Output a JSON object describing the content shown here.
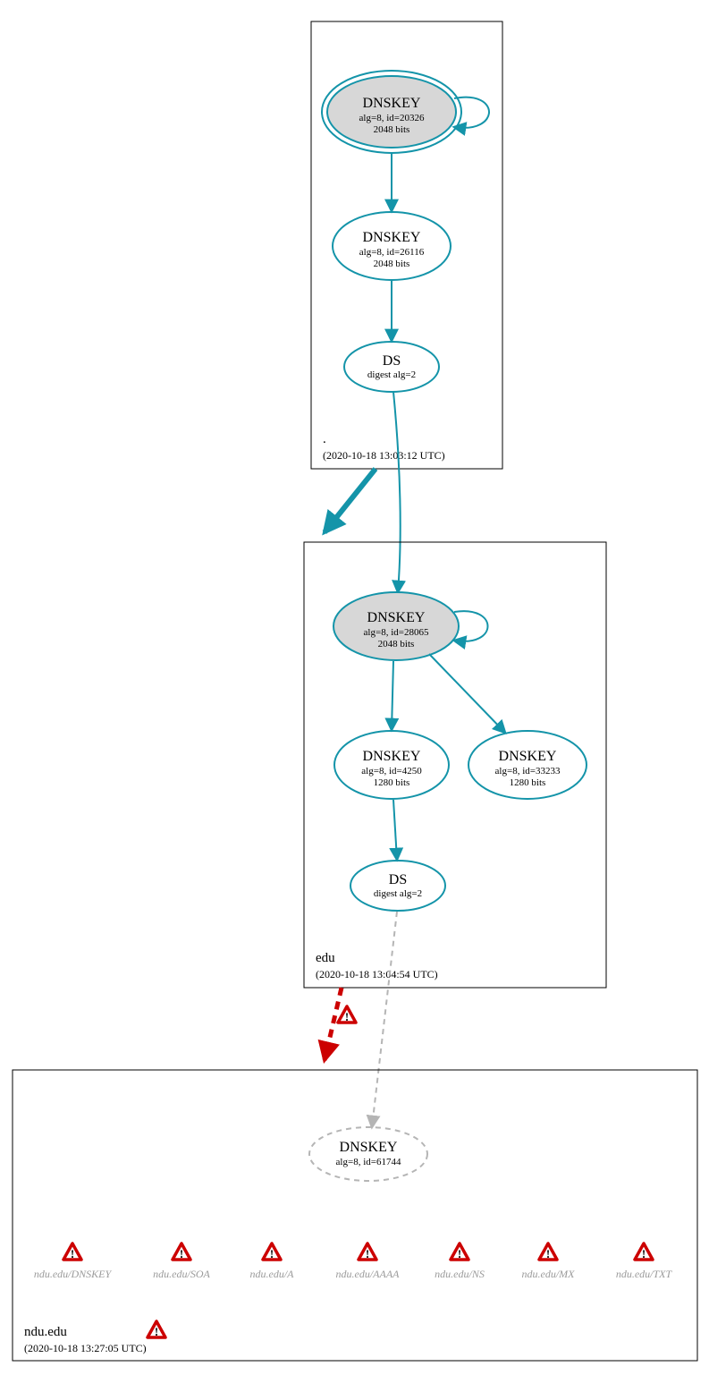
{
  "zones": {
    "root": {
      "label": ".",
      "timestamp": "(2020-10-18 13:03:12 UTC)"
    },
    "edu": {
      "label": "edu",
      "timestamp": "(2020-10-18 13:04:54 UTC)"
    },
    "ndu": {
      "label": "ndu.edu",
      "timestamp": "(2020-10-18 13:27:05 UTC)"
    }
  },
  "nodes": {
    "root_ksk": {
      "title": "DNSKEY",
      "line2": "alg=8, id=20326",
      "line3": "2048 bits"
    },
    "root_zsk": {
      "title": "DNSKEY",
      "line2": "alg=8, id=26116",
      "line3": "2048 bits"
    },
    "root_ds": {
      "title": "DS",
      "line2": "digest alg=2"
    },
    "edu_ksk": {
      "title": "DNSKEY",
      "line2": "alg=8, id=28065",
      "line3": "2048 bits"
    },
    "edu_zsk1": {
      "title": "DNSKEY",
      "line2": "alg=8, id=4250",
      "line3": "1280 bits"
    },
    "edu_zsk2": {
      "title": "DNSKEY",
      "line2": "alg=8, id=33233",
      "line3": "1280 bits"
    },
    "edu_ds": {
      "title": "DS",
      "line2": "digest alg=2"
    },
    "ndu_key": {
      "title": "DNSKEY",
      "line2": "alg=8, id=61744"
    }
  },
  "rr": [
    "ndu.edu/DNSKEY",
    "ndu.edu/SOA",
    "ndu.edu/A",
    "ndu.edu/AAAA",
    "ndu.edu/NS",
    "ndu.edu/MX",
    "ndu.edu/TXT"
  ]
}
